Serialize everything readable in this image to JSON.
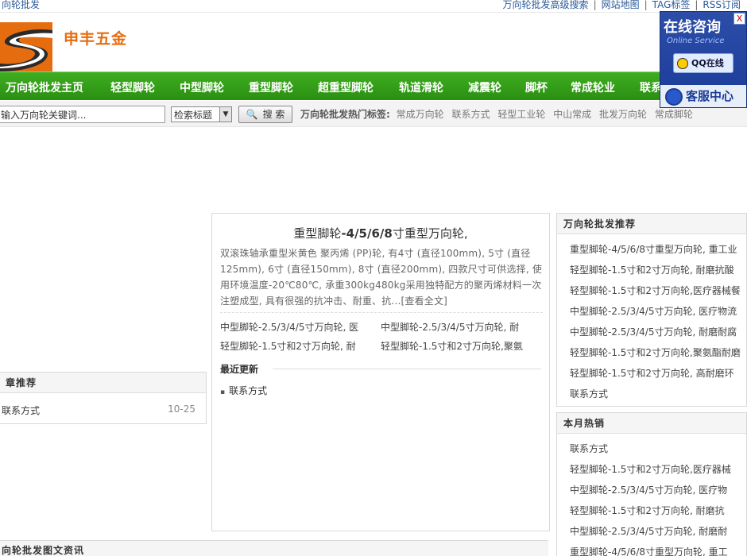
{
  "topbar": {
    "left_link": "向轮批发",
    "links": [
      "万向轮批发高级搜索",
      "网站地图",
      "TAG标签",
      "RSS订阅"
    ]
  },
  "header": {
    "logo_text": "申丰五金",
    "colors": {
      "logo_orange": "#e66c10",
      "nav_green": "#2f9a16"
    }
  },
  "nav": {
    "items": [
      "万向轮批发主页",
      "轻型脚轮",
      "中型脚轮",
      "重型脚轮",
      "超重型脚轮",
      "轨道滑轮",
      "减震轮",
      "脚杯",
      "常成轮业",
      "联系"
    ]
  },
  "search": {
    "input_value": "输入万向轮关键词...",
    "select_value": "检索标题",
    "button_label": "搜 索",
    "hot_label": "万向轮批发热门标签:",
    "hot_tags": [
      "常成万向轮",
      "联系方式",
      "轻型工业轮",
      "中山常成",
      "批发万向轮",
      "常成脚轮"
    ]
  },
  "float_widget": {
    "title": "在线咨询",
    "subtitle": "Online Service",
    "close": "X",
    "qq_label": "QQ在线",
    "service_label": "客服中心"
  },
  "left_panel": {
    "heading": "章推荐",
    "item_title": "联系方式",
    "item_date": "10-25"
  },
  "bottom_panel": {
    "heading": "向轮批发图文资讯"
  },
  "center": {
    "title_pre": "重型脚轮",
    "title_bold": "-4/5/6/8",
    "title_post": "寸重型万向轮,",
    "description": "双滚珠轴承重型米黄色 聚丙烯 (PP)轮, 有4寸 (直径100mm), 5寸 (直径125mm), 6寸 (直径150mm), 8寸 (直径200mm), 四款尺寸可供选择, 使用环境温度-20℃80℃, 承重300kg480kg采用独特配方的聚丙烯材料一次注塑成型, 具有很强的抗冲击、耐重、抗...[查看全文]",
    "links": [
      "中型脚轮-2.5/3/4/5寸万向轮, 医",
      "中型脚轮-2.5/3/4/5寸万向轮, 耐",
      "轻型脚轮-1.5寸和2寸万向轮, 耐",
      "轻型脚轮-1.5寸和2寸万向轮,聚氨"
    ],
    "recent_heading": "最近更新",
    "recent_item": "联系方式"
  },
  "right_recommend": {
    "heading": "万向轮批发推荐",
    "items": [
      "重型脚轮-4/5/6/8寸重型万向轮, 重工业",
      "轻型脚轮-1.5寸和2寸万向轮, 耐磨抗酸",
      "轻型脚轮-1.5寸和2寸万向轮,医疗器械餐",
      "中型脚轮-2.5/3/4/5寸万向轮, 医疗物流",
      "中型脚轮-2.5/3/4/5寸万向轮, 耐磨耐腐",
      "轻型脚轮-1.5寸和2寸万向轮,聚氨酯耐磨",
      "轻型脚轮-1.5寸和2寸万向轮, 高耐磨环",
      "联系方式"
    ]
  },
  "right_hot": {
    "heading": "本月热销",
    "items": [
      "联系方式",
      "轻型脚轮-1.5寸和2寸万向轮,医疗器械",
      "中型脚轮-2.5/3/4/5寸万向轮, 医疗物",
      "轻型脚轮-1.5寸和2寸万向轮, 耐磨抗",
      "中型脚轮-2.5/3/4/5寸万向轮, 耐磨耐",
      "重型脚轮-4/5/6/8寸重型万向轮, 重工"
    ]
  }
}
